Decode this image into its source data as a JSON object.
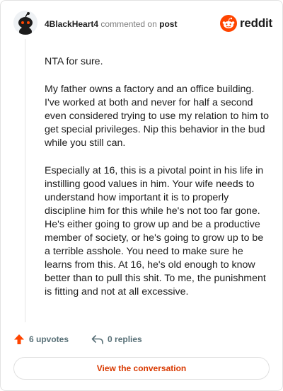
{
  "comment": {
    "username": "4BlackHeart4",
    "action_text": "commented on",
    "target_link": "post",
    "paragraphs": [
      "NTA for sure.",
      "My father owns a factory and an office building. I've worked at both and never for half a second even considered trying to use my relation to him to get special privileges. Nip this behavior in the bud while you still can.",
      "Especially at 16, this is a pivotal point in his life in instilling good values in him. Your wife needs to understand how important it is to properly discipline him for this while he's not too far gone. He's either going to grow up and be a productive member of society, or he's going to grow up to be a terrible asshole. You need to make sure he learns from this. At 16, he's old enough to know better than to pull this shit. To me, the punishment is fitting and not at all excessive."
    ]
  },
  "brand": {
    "wordmark": "reddit",
    "color": "#ff4500"
  },
  "stats": {
    "upvotes": "6 upvotes",
    "replies": "0 replies",
    "upvote_icon": "upvote-arrow-icon",
    "reply_icon": "reply-arrow-icon"
  },
  "cta": {
    "label": "View the conversation",
    "color": "#d93900"
  }
}
